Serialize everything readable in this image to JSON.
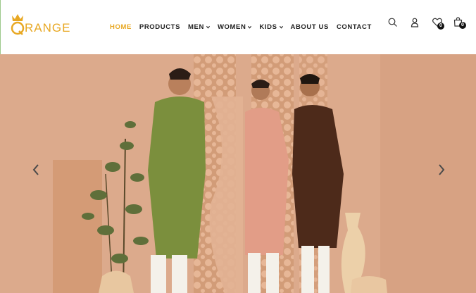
{
  "brand": {
    "logo_text": "RANGE"
  },
  "nav": {
    "items": [
      {
        "label": "HOME",
        "active": true,
        "dropdown": false
      },
      {
        "label": "PRODUCTS",
        "active": false,
        "dropdown": false
      },
      {
        "label": "MEN",
        "active": false,
        "dropdown": true
      },
      {
        "label": "WOMEN",
        "active": false,
        "dropdown": true
      },
      {
        "label": "KIDS",
        "active": false,
        "dropdown": true
      },
      {
        "label": "ABOUT US",
        "active": false,
        "dropdown": false
      },
      {
        "label": "CONTACT",
        "active": false,
        "dropdown": false
      }
    ]
  },
  "header_icons": {
    "search": "search-icon",
    "account": "user-icon",
    "wishlist": {
      "icon": "heart-icon",
      "count": "0"
    },
    "cart": {
      "icon": "shopping-bag-icon",
      "count": "0"
    }
  },
  "hero": {
    "prev_icon": "chevron-left-icon",
    "next_icon": "chevron-right-icon"
  },
  "colors": {
    "accent": "#e8a823",
    "text": "#222222",
    "hero_bg": "#dfad90"
  }
}
